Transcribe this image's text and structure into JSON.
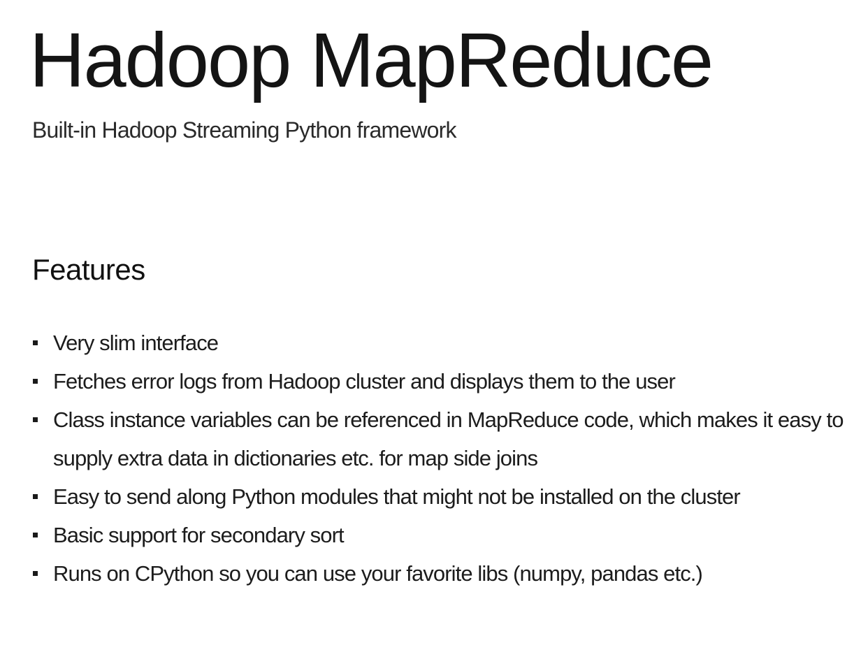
{
  "slide": {
    "title": "Hadoop MapReduce",
    "subtitle": "Built-in Hadoop Streaming Python framework",
    "section_heading": "Features",
    "features": [
      "Very slim interface",
      "Fetches error logs from Hadoop cluster and displays them to the user",
      "Class instance variables can be referenced in MapReduce code, which makes it easy to supply extra data in dictionaries etc. for map side joins",
      "Easy to send along Python modules that might not be installed on the cluster",
      "Basic support for secondary sort",
      "Runs on CPython so you can use your favorite libs (numpy, pandas etc.)"
    ]
  },
  "colors": {
    "background": "#ffffff",
    "text": "#111111"
  },
  "icons": {
    "bullet": "square-bullet-icon"
  }
}
